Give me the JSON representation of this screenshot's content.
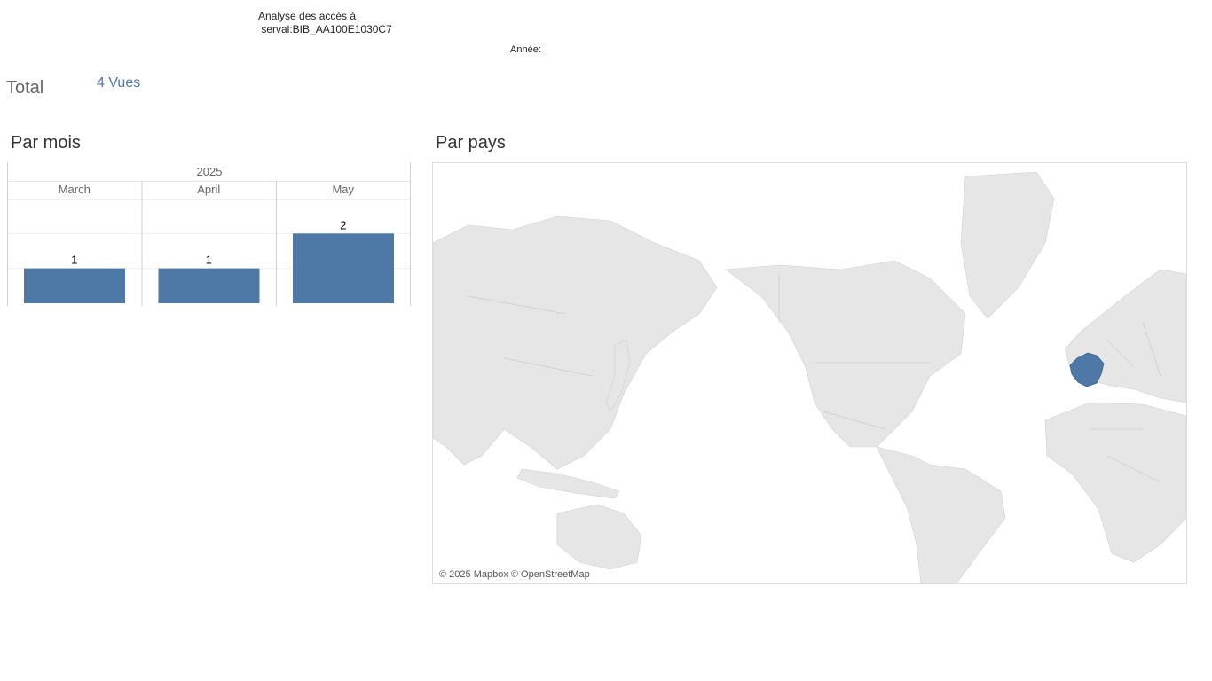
{
  "header": {
    "title": "Analyse des accès à\n serval:BIB_AA100E1030C7",
    "year_label": "Année:"
  },
  "summary": {
    "total_label": "Total",
    "total_value": "4 Vues"
  },
  "by_month": {
    "title": "Par mois"
  },
  "by_country": {
    "title": "Par pays",
    "attribution": "© 2025 Mapbox © OpenStreetMap",
    "highlighted_country": "France",
    "highlight_color": "#4e79a7",
    "land_color": "#e6e6e6"
  },
  "chart_data": {
    "type": "bar",
    "group_label": "2025",
    "categories": [
      "March",
      "April",
      "May"
    ],
    "values": [
      1,
      1,
      2
    ],
    "ylim": [
      0,
      2
    ],
    "bar_color": "#4e79a7",
    "grid": true
  }
}
